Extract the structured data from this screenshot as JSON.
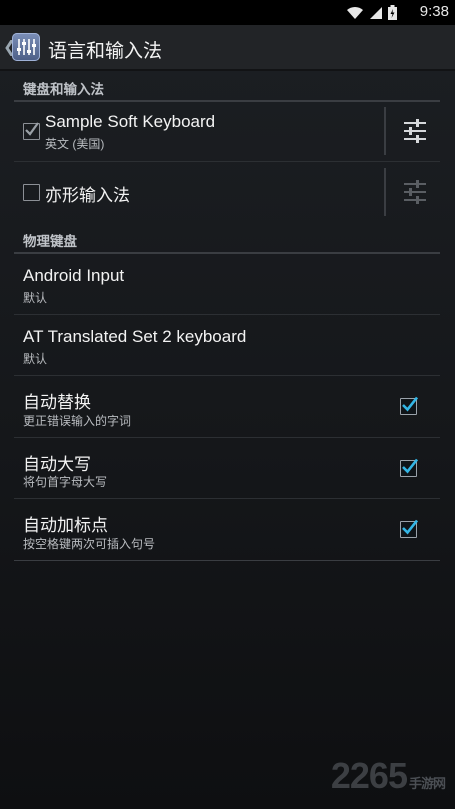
{
  "statusbar": {
    "time": "9:38"
  },
  "actionbar": {
    "title": "语言和输入法"
  },
  "sections": {
    "keyboard_input": "键盘和输入法",
    "physical_keyboard": "物理键盘"
  },
  "keyboards": [
    {
      "title": "Sample Soft Keyboard",
      "subtitle": "英文 (美国)",
      "checked": true
    },
    {
      "title": "亦形输入法",
      "subtitle": "",
      "checked": false
    }
  ],
  "physical": [
    {
      "title": "Android Input",
      "subtitle": "默认"
    },
    {
      "title": "AT Translated Set 2 keyboard",
      "subtitle": "默认"
    }
  ],
  "options": [
    {
      "title": "自动替换",
      "subtitle": "更正错误输入的字词",
      "checked": true
    },
    {
      "title": "自动大写",
      "subtitle": "将句首字母大写",
      "checked": true
    },
    {
      "title": "自动加标点",
      "subtitle": "按空格键两次可插入句号",
      "checked": true
    }
  ],
  "watermark": {
    "text": "2265",
    "suffix": "手游网"
  },
  "colors": {
    "accent": "#33b5e5",
    "background": "#1a1c1f"
  }
}
